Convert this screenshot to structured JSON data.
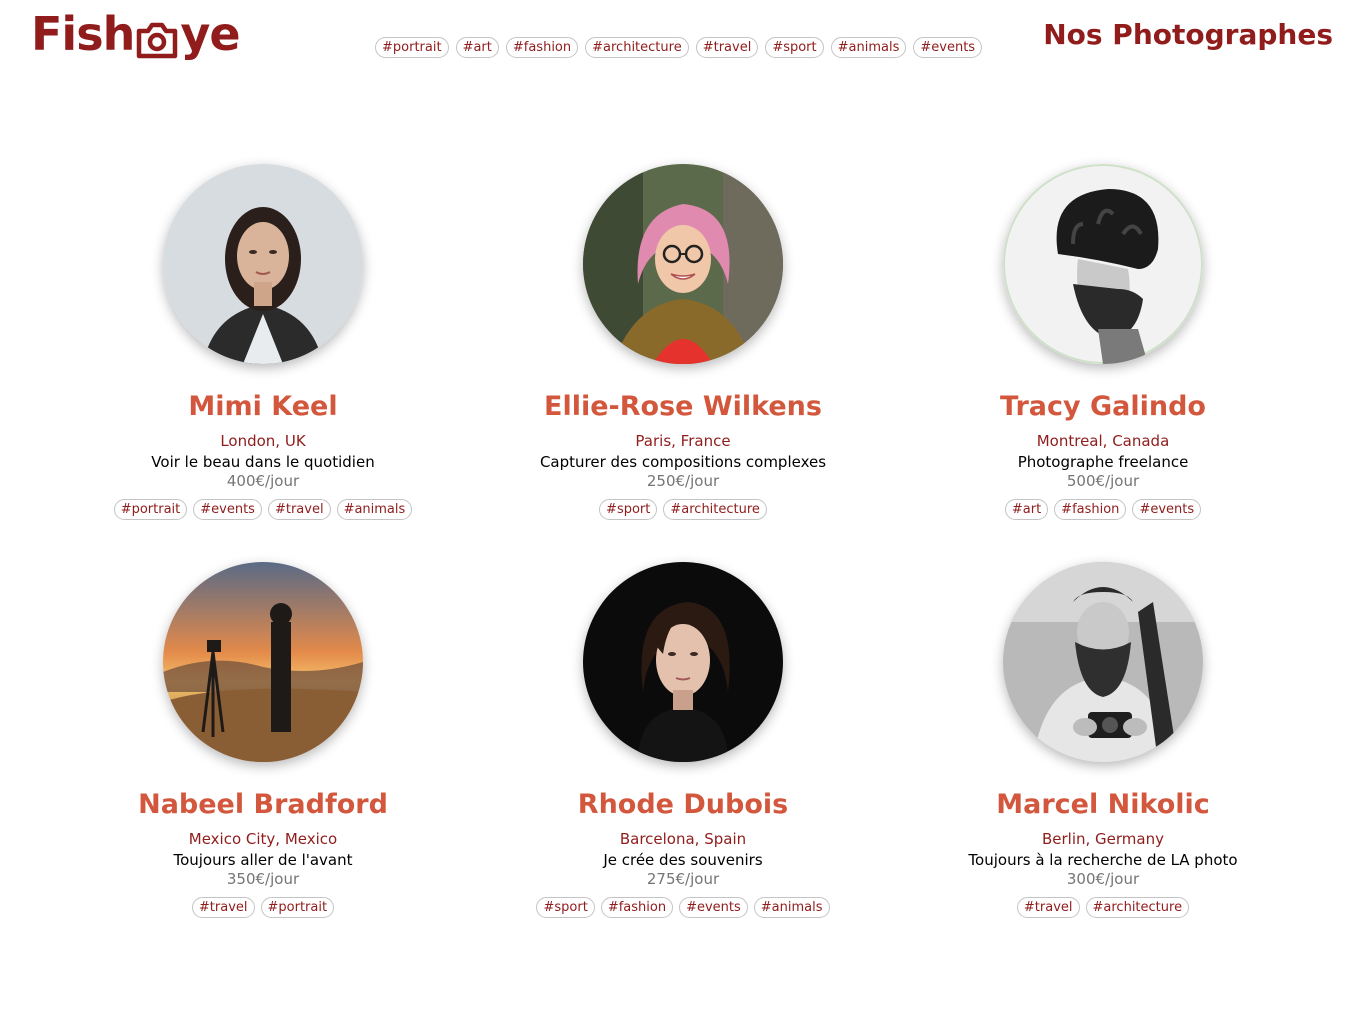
{
  "header": {
    "logo_text_left": "Fish",
    "logo_text_right": "ye",
    "logo_icon": "camera-icon",
    "title": "Nos Photographes",
    "nav_tags": [
      "#portrait",
      "#art",
      "#fashion",
      "#architecture",
      "#travel",
      "#sport",
      "#animals",
      "#events"
    ]
  },
  "colors": {
    "brand": "#901c1c",
    "name": "#d3573c",
    "price": "#757575"
  },
  "photographers": [
    {
      "name": "Mimi Keel",
      "location": "London, UK",
      "tagline": "Voir le beau dans le quotidien",
      "price": "400€/jour",
      "tags": [
        "#portrait",
        "#events",
        "#travel",
        "#animals"
      ]
    },
    {
      "name": "Ellie-Rose Wilkens",
      "location": "Paris, France",
      "tagline": "Capturer des compositions complexes",
      "price": "250€/jour",
      "tags": [
        "#sport",
        "#architecture"
      ]
    },
    {
      "name": "Tracy Galindo",
      "location": "Montreal, Canada",
      "tagline": "Photographe freelance",
      "price": "500€/jour",
      "tags": [
        "#art",
        "#fashion",
        "#events"
      ]
    },
    {
      "name": "Nabeel Bradford",
      "location": "Mexico City, Mexico",
      "tagline": "Toujours aller de l'avant",
      "price": "350€/jour",
      "tags": [
        "#travel",
        "#portrait"
      ]
    },
    {
      "name": "Rhode Dubois",
      "location": "Barcelona, Spain",
      "tagline": "Je crée des souvenirs",
      "price": "275€/jour",
      "tags": [
        "#sport",
        "#fashion",
        "#events",
        "#animals"
      ]
    },
    {
      "name": "Marcel Nikolic",
      "location": "Berlin, Germany",
      "tagline": "Toujours à la recherche de LA photo",
      "price": "300€/jour",
      "tags": [
        "#travel",
        "#architecture"
      ]
    }
  ]
}
